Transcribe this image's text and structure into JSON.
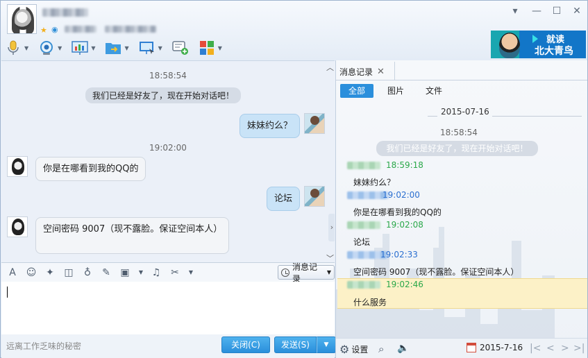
{
  "window": {
    "minimize_glyph": "▾",
    "restore_glyph": "—",
    "maximize_glyph": "☐",
    "close_glyph": "✕"
  },
  "banner": {
    "line1": "就读",
    "line2": "北大青鸟"
  },
  "chat": {
    "time1": "18:58:54",
    "system_msg": "我们已经是好友了，现在开始对话吧！",
    "msg1": "妹妹约么？",
    "time2": "19:02:00",
    "msg2": "你是在哪看到我的QQ的",
    "msg3": "论坛",
    "msg4": "空间密码  9007（现不露脸。保证空间本人）"
  },
  "input": {
    "history_label": "消息记录",
    "slogan": "远离工作乏味的秘密",
    "close_label": "关闭(C)",
    "send_label": "发送(S)"
  },
  "history": {
    "tab_label": "消息记录",
    "filters": [
      "全部",
      "图片",
      "文件"
    ],
    "date": "2015-07-16",
    "time0": "18:58:54",
    "system_msg": "我们已经是好友了，现在开始对话吧！",
    "entries": [
      {
        "time": "18:59:18",
        "text": "妹妹约么？",
        "color": "#2ba84a"
      },
      {
        "time": "19:02:00",
        "text": "你是在哪看到我的QQ的",
        "color": "#2b6fd0"
      },
      {
        "time": "19:02:08",
        "text": "论坛",
        "color": "#2ba84a"
      },
      {
        "time": "19:02:33",
        "text": "空间密码  9007（现不露脸。保证空间本人）",
        "color": "#2b6fd0"
      },
      {
        "time": "19:02:46",
        "text": "什么服务",
        "color": "#2ba84a"
      }
    ],
    "settings_label": "设置",
    "footer_date": "2015-7-16"
  },
  "colors": {
    "accent": "#2b8fdc",
    "self_name": "#2ba84a",
    "peer_name": "#2b6fd0",
    "highlight": "#fcf1c7"
  }
}
